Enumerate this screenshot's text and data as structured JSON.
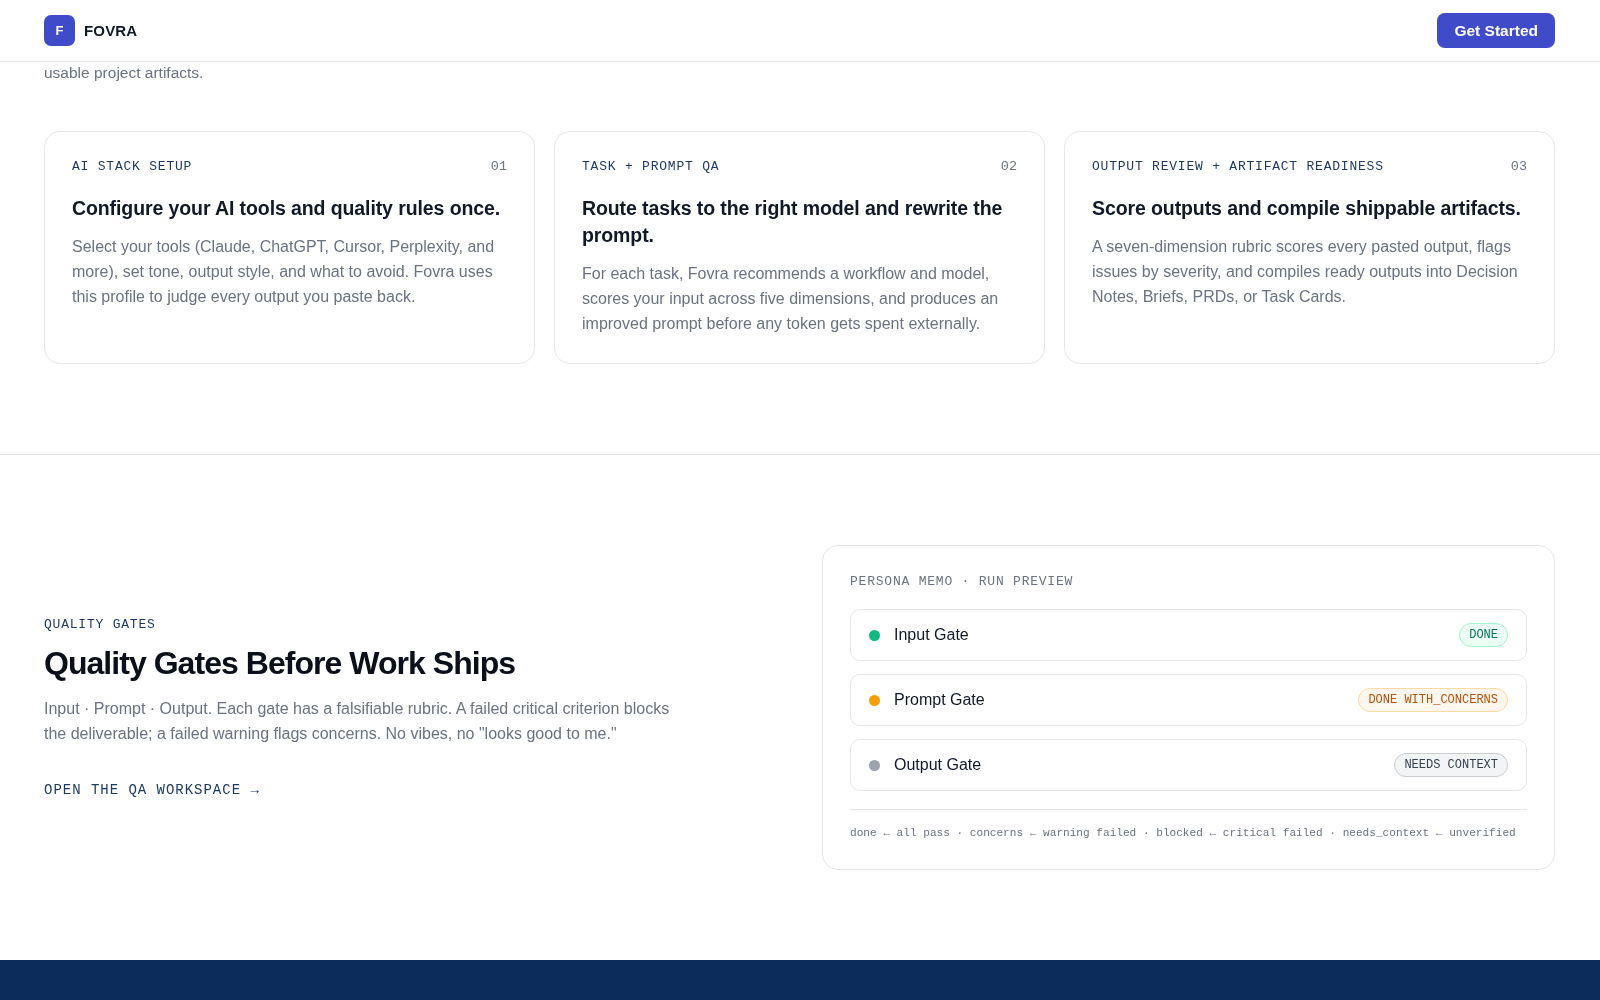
{
  "header": {
    "logo_letter": "F",
    "brand": "FOVRA",
    "cta": "Get Started"
  },
  "intro": {
    "text": "usable project artifacts."
  },
  "steps": [
    {
      "label": "AI STACK SETUP",
      "number": "01",
      "title": "Configure your AI tools and quality rules once.",
      "body": "Select your tools (Claude, ChatGPT, Cursor, Perplexity, and more), set tone, output style, and what to avoid. Fovra uses this profile to judge every output you paste back."
    },
    {
      "label": "TASK + PROMPT QA",
      "number": "02",
      "title": "Route tasks to the right model and rewrite the prompt.",
      "body": "For each task, Fovra recommends a workflow and model, scores your input across five dimensions, and produces an improved prompt before any token gets spent externally."
    },
    {
      "label": "OUTPUT REVIEW + ARTIFACT READINESS",
      "number": "03",
      "title": "Score outputs and compile shippable artifacts.",
      "body": "A seven-dimension rubric scores every pasted output, flags issues by severity, and compiles ready outputs into Decision Notes, Briefs, PRDs, or Task Cards."
    }
  ],
  "quality_gates": {
    "eyebrow": "QUALITY GATES",
    "heading": "Quality Gates Before Work Ships",
    "body": "Input · Prompt · Output. Each gate has a falsifiable rubric. A failed critical criterion blocks the deliverable; a failed warning flags concerns. No vibes, no \"looks good to me.\"",
    "link": "OPEN THE QA WORKSPACE →"
  },
  "run_preview": {
    "title": "PERSONA MEMO · RUN PREVIEW",
    "gates": [
      {
        "name": "Input Gate",
        "status": "DONE",
        "kind": "done",
        "color": "#10b981"
      },
      {
        "name": "Prompt Gate",
        "status": "DONE WITH_CONCERNS",
        "kind": "concerns",
        "color": "#f59e0b"
      },
      {
        "name": "Output Gate",
        "status": "NEEDS CONTEXT",
        "kind": "needs_context",
        "color": "#9ca3af"
      }
    ],
    "legend": "done ← all pass · concerns ← warning failed · blocked ← critical failed · needs_context ← unverified"
  }
}
